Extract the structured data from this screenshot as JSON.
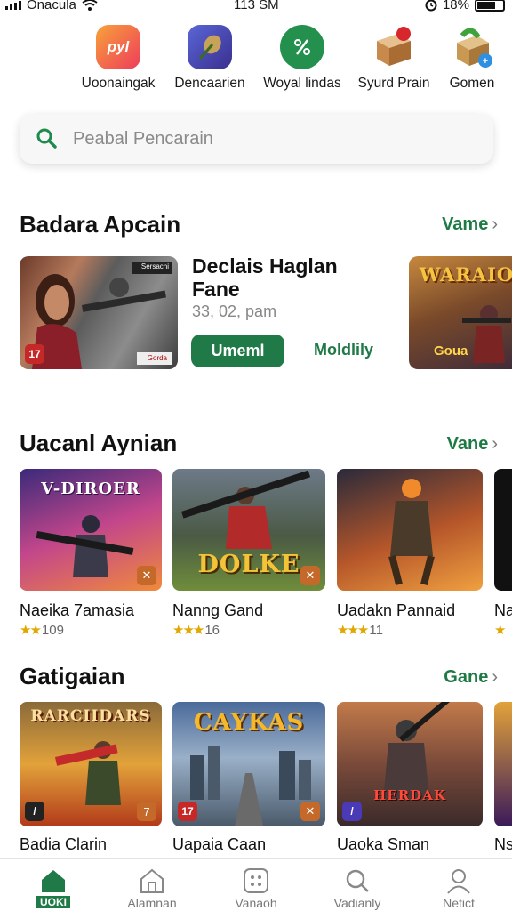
{
  "status_bar": {
    "carrier": "Onacula",
    "time": "113 SM",
    "battery": "18%"
  },
  "categories": [
    {
      "label": "Uoonaingak",
      "icon": "app-logo-icon",
      "color": "#f0553a"
    },
    {
      "label": "Dencaarien",
      "icon": "feather-pen-icon",
      "color": "#4b55b8"
    },
    {
      "label": "Woyal lindas",
      "icon": "percent-tag-icon",
      "color": "#23914d"
    },
    {
      "label": "Syurd Prain",
      "icon": "gift-box-icon",
      "color": "#c88a4c"
    },
    {
      "label": "Gomen",
      "icon": "gift-ribbon-icon",
      "color": "#7b9c3a"
    }
  ],
  "search": {
    "placeholder": "Peabal Pencarain"
  },
  "featured_section": {
    "title": "Badara Apcain",
    "see_all": "Vame",
    "item": {
      "name": "Declais Haglan Fane",
      "meta": "33, 02, pam",
      "install_label": "Umeml",
      "more_label": "Moldlily",
      "badge": "17",
      "logo_text": "Sersachi",
      "caption_text": "Gorda"
    },
    "next_item": {
      "title_art": "WARAIO",
      "caption": "Goua"
    }
  },
  "action_section": {
    "title": "Uacanl Aynian",
    "see_all": "Vane",
    "cards": [
      {
        "title": "Naeika 7amasia",
        "stars": "★★",
        "rating": "109",
        "art": "V-DIROER"
      },
      {
        "title": "Nanng Gand",
        "stars": "★★★",
        "rating": "16",
        "art": "DOLKE"
      },
      {
        "title": "Uadakn Pannaid",
        "stars": "★★★",
        "rating": "11",
        "art": ""
      },
      {
        "title": "Na",
        "stars": "★",
        "rating": "",
        "art": ""
      }
    ]
  },
  "games_section": {
    "title": "Gatigaian",
    "see_all": "Gane",
    "cards": [
      {
        "title": "Badia Clarin",
        "art": "RARCIIDARS",
        "badge": "7"
      },
      {
        "title": "Uapaia Caan",
        "art": "CAYKAS",
        "badge": "17"
      },
      {
        "title": "Uaoka Sman",
        "art": "HERDAK",
        "badge": ""
      },
      {
        "title": "Ns",
        "art": "",
        "badge": ""
      }
    ]
  },
  "bottom_nav": [
    {
      "label": "UOKI",
      "icon": "home-icon",
      "active": true
    },
    {
      "label": "Alamnan",
      "icon": "store-icon",
      "active": false
    },
    {
      "label": "Vanaoh",
      "icon": "grid-apps-icon",
      "active": false
    },
    {
      "label": "Vadianly",
      "icon": "search-icon",
      "active": false
    },
    {
      "label": "Netict",
      "icon": "profile-icon",
      "active": false
    }
  ],
  "colors": {
    "accent": "#1f7a48",
    "star": "#e0a800"
  }
}
